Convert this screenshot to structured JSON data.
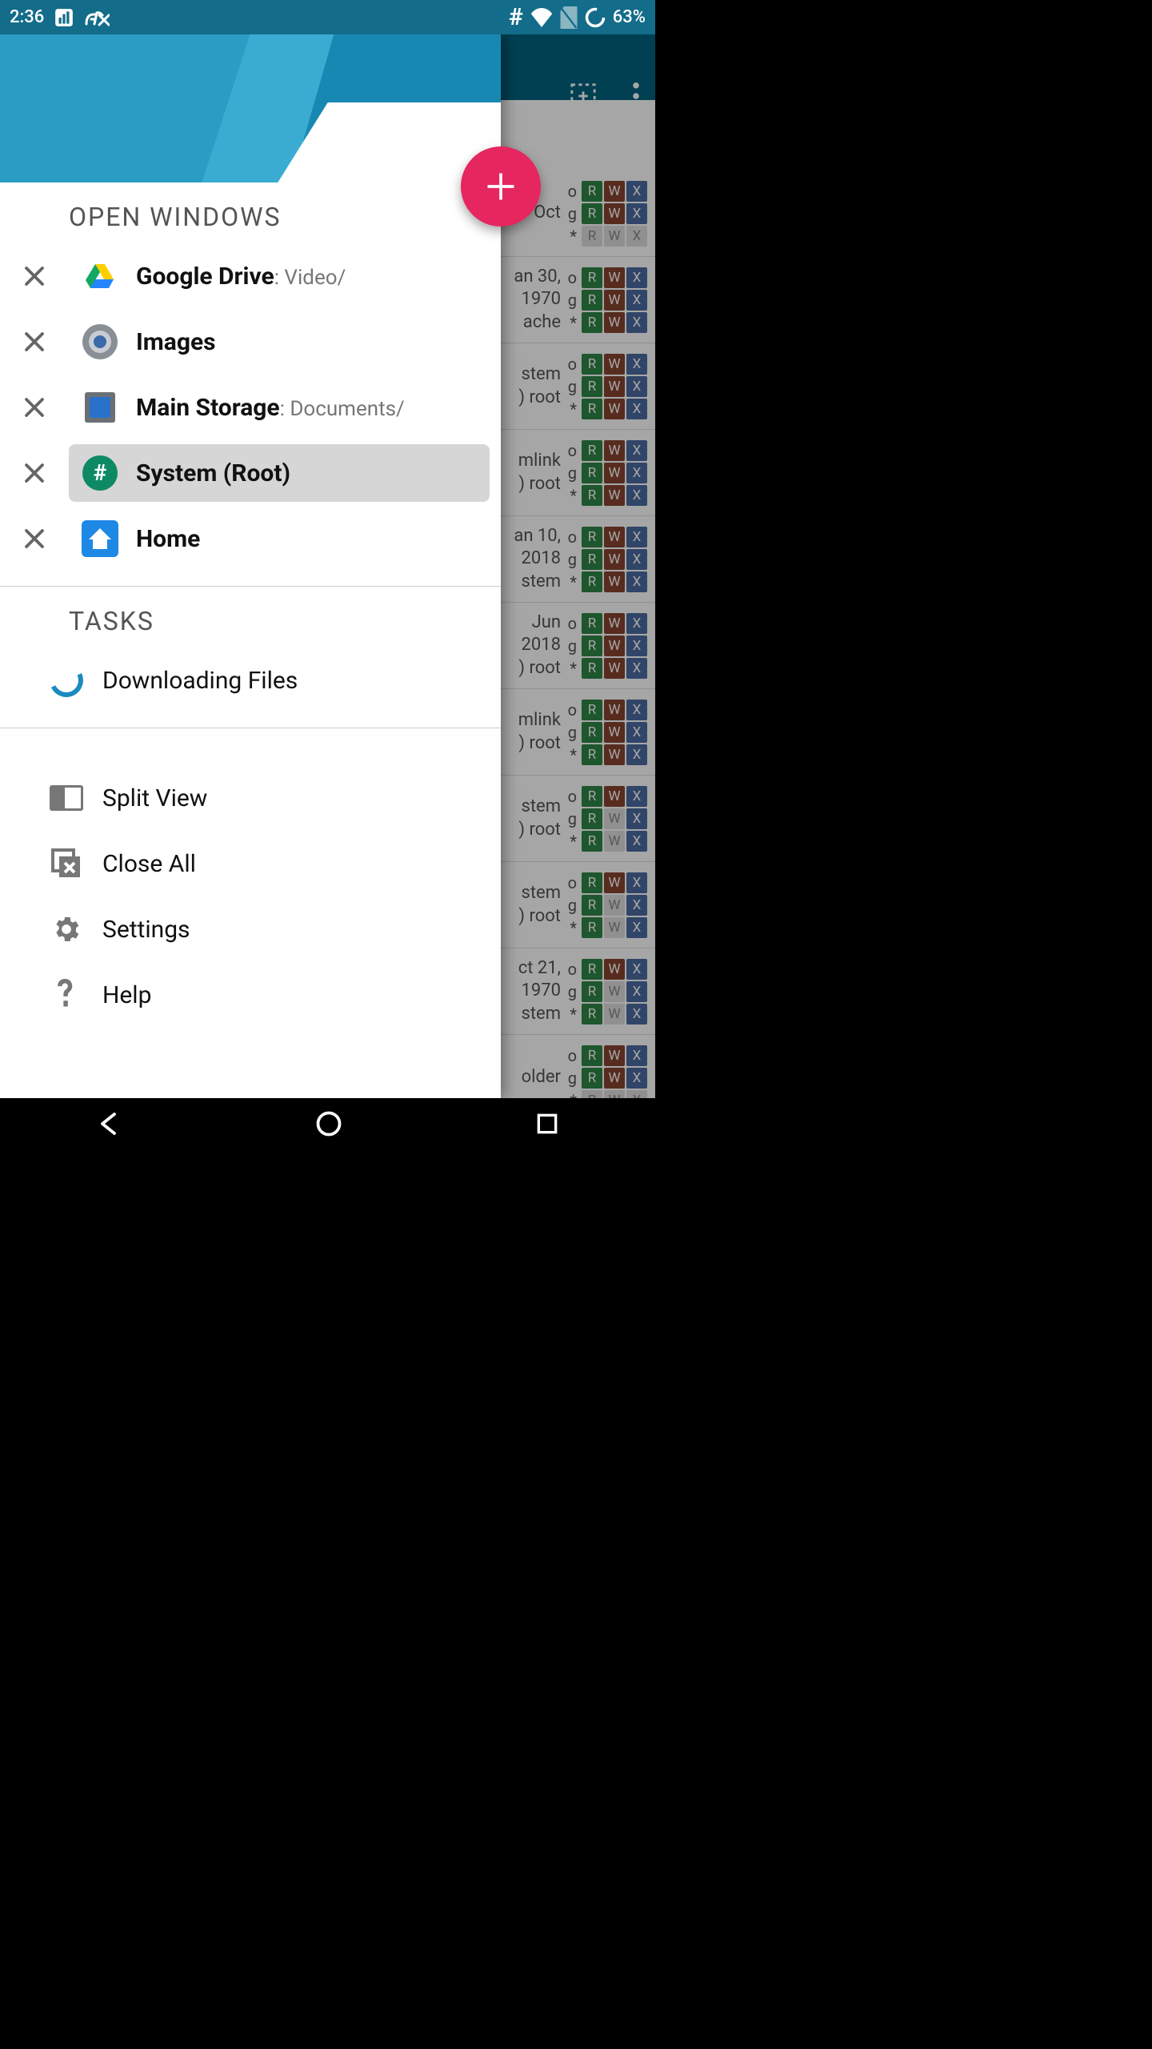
{
  "status_bar": {
    "time": "2:36",
    "battery": "63%"
  },
  "drawer": {
    "sections": {
      "open_windows_title": "OPEN WINDOWS",
      "tasks_title": "TASKS"
    },
    "windows": [
      {
        "name": "Google Drive",
        "sub": ": Video/",
        "icon": "google-drive",
        "selected": false
      },
      {
        "name": "Images",
        "sub": "",
        "icon": "images",
        "selected": false
      },
      {
        "name": "Main Storage",
        "sub": ": Documents/",
        "icon": "storage",
        "selected": false
      },
      {
        "name": "System (Root)",
        "sub": "",
        "icon": "root",
        "selected": true
      },
      {
        "name": "Home",
        "sub": "",
        "icon": "home",
        "selected": false
      }
    ],
    "tasks": [
      {
        "label": "Downloading Files"
      }
    ],
    "actions": {
      "split_view": "Split View",
      "close_all": "Close All",
      "settings": "Settings",
      "help": "Help"
    }
  },
  "background": {
    "rows": [
      {
        "date_a": "Oct",
        "date_b": "",
        "extra": "",
        "o": [
          true,
          true,
          true
        ],
        "g": [
          true,
          true,
          true
        ],
        "s": [
          false,
          false,
          false
        ]
      },
      {
        "date_a": "an 30,",
        "date_b": "1970",
        "extra": "ache",
        "o": [
          true,
          true,
          true
        ],
        "g": [
          true,
          true,
          true
        ],
        "s": [
          true,
          true,
          true
        ]
      },
      {
        "date_a": "",
        "date_b": "stem",
        "extra": ") root",
        "o": [
          true,
          true,
          true
        ],
        "g": [
          true,
          true,
          true
        ],
        "s": [
          true,
          true,
          true
        ]
      },
      {
        "date_a": "",
        "date_b": "mlink",
        "extra": ") root",
        "o": [
          true,
          true,
          true
        ],
        "g": [
          true,
          true,
          true
        ],
        "s": [
          true,
          true,
          true
        ]
      },
      {
        "date_a": "an 10,",
        "date_b": "2018",
        "extra": "stem",
        "o": [
          true,
          true,
          true
        ],
        "g": [
          true,
          true,
          true
        ],
        "s": [
          true,
          true,
          true
        ]
      },
      {
        "date_a": "Jun",
        "date_b": "2018",
        "extra": ") root",
        "o": [
          true,
          true,
          true
        ],
        "g": [
          true,
          true,
          true
        ],
        "s": [
          true,
          true,
          true
        ]
      },
      {
        "date_a": "",
        "date_b": "mlink",
        "extra": ") root",
        "o": [
          true,
          true,
          true
        ],
        "g": [
          true,
          true,
          true
        ],
        "s": [
          true,
          true,
          true
        ]
      },
      {
        "date_a": "",
        "date_b": "stem",
        "extra": ") root",
        "o": [
          true,
          true,
          true
        ],
        "g": [
          true,
          false,
          true
        ],
        "s": [
          true,
          false,
          true
        ]
      },
      {
        "date_a": "",
        "date_b": "stem",
        "extra": ") root",
        "o": [
          true,
          true,
          true
        ],
        "g": [
          true,
          false,
          true
        ],
        "s": [
          true,
          false,
          true
        ]
      },
      {
        "date_a": "ct 21,",
        "date_b": "1970",
        "extra": "stem",
        "o": [
          true,
          true,
          true
        ],
        "g": [
          true,
          false,
          true
        ],
        "s": [
          true,
          false,
          true
        ]
      },
      {
        "date_a": "",
        "date_b": "older",
        "extra": "",
        "o": [
          true,
          true,
          true
        ],
        "g": [
          true,
          true,
          true
        ],
        "s": [
          false,
          false,
          false
        ]
      }
    ]
  }
}
